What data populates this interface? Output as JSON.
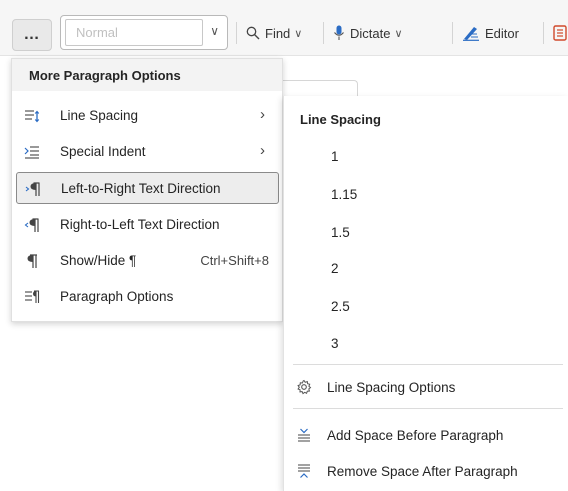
{
  "toolbar": {
    "more_label": "…",
    "style_value": "Normal",
    "find_label": "Find",
    "dictate_label": "Dictate",
    "editor_label": "Editor",
    "chevron": "∨"
  },
  "menu": {
    "header": "More Paragraph Options",
    "items": [
      {
        "label": "Line Spacing",
        "icon": "line-spacing-icon",
        "submenu": true
      },
      {
        "label": "Special Indent",
        "icon": "special-indent-icon",
        "submenu": true
      },
      {
        "label": "Left-to-Right Text Direction",
        "icon": "ltr-direction-icon",
        "selected": true
      },
      {
        "label": "Right-to-Left Text Direction",
        "icon": "rtl-direction-icon"
      },
      {
        "label": "Show/Hide ¶",
        "icon": "pilcrow-icon",
        "shortcut": "Ctrl+Shift+8"
      },
      {
        "label": "Paragraph Options",
        "icon": "paragraph-options-icon"
      }
    ]
  },
  "submenu": {
    "header": "Line Spacing",
    "options": [
      "1",
      "1.15",
      "1.5",
      "2",
      "2.5",
      "3"
    ],
    "actions": [
      {
        "label": "Line Spacing Options",
        "icon": "gear-icon"
      },
      {
        "label": "Add Space Before Paragraph",
        "icon": "add-space-before-icon"
      },
      {
        "label": "Remove Space After Paragraph",
        "icon": "remove-space-after-icon"
      }
    ]
  },
  "colors": {
    "accent_blue": "#2b6cc4",
    "toolbar_bg": "#f6f6f6",
    "selected_bg": "#ededed"
  }
}
